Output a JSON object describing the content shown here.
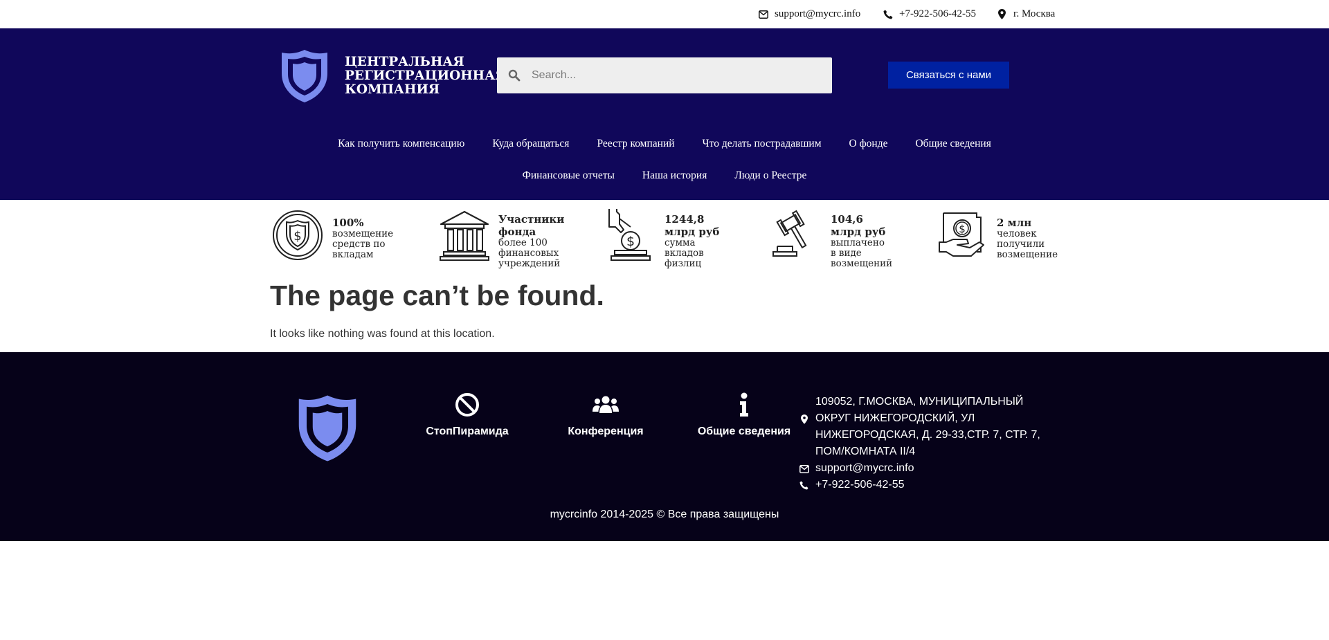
{
  "topbar": {
    "email": "support@mycrc.info",
    "phone": "+7-922-506-42-55",
    "city": "г. Москва"
  },
  "header": {
    "brand_lines": [
      "ЦЕНТРАЛЬНАЯ",
      "РЕГИСТРАЦИОННАЯ",
      "КОМПАНИЯ"
    ],
    "search_placeholder": "Search...",
    "cta_label": "Связаться с нами",
    "colors": {
      "header_bg": "#10075a",
      "accent": "#0021a1",
      "logo": "#7b8cef"
    }
  },
  "nav": {
    "row1": [
      "Как получить компенсацию",
      "Куда обращаться",
      "Реестр компаний",
      "Что делать пострадавшим",
      "О фонде",
      "Общие сведения"
    ],
    "row2": [
      "Финансовые отчеты",
      "Наша история",
      "Люди о Реестре"
    ]
  },
  "stats": [
    {
      "icon": "shield-dollar-icon",
      "title": "100%",
      "lines": [
        "возмещение",
        "средств по",
        "вкладам"
      ]
    },
    {
      "icon": "bank-building-icon",
      "title": "Участники фонда",
      "lines": [
        "более 100",
        "финансовых",
        "учреждений"
      ]
    },
    {
      "icon": "hand-coin-icon",
      "title": "1244,8 млрд руб",
      "lines": [
        "сумма",
        "вкладов",
        "физлиц"
      ]
    },
    {
      "icon": "gavel-icon",
      "title": "104,6 млрд руб",
      "lines": [
        "выплачено",
        "в виде",
        "возмещений"
      ]
    },
    {
      "icon": "hand-money-icon",
      "title": "2 млн",
      "lines": [
        "человек",
        "получили",
        "возмещение"
      ]
    }
  ],
  "main": {
    "title": "The page can’t be found.",
    "text": "It looks like nothing was found at this location."
  },
  "footer": {
    "links": [
      {
        "icon": "ban-icon",
        "label": "СтопПирамида"
      },
      {
        "icon": "users-icon",
        "label": "Конференция"
      },
      {
        "icon": "info-icon",
        "label": "Общие сведения"
      }
    ],
    "address": "109052, г.Москва, муниципальный округ Нижегородский, ул Нижегородская, д. 29-33,стр. 7, стр. 7, пом/комната II/4",
    "email": "support@mycrc.info",
    "phone": "+7-922-506-42-55",
    "copyright": "mycrcinfo 2014-2025 © Все права защищены",
    "colors": {
      "footer_bg": "#060219"
    }
  }
}
